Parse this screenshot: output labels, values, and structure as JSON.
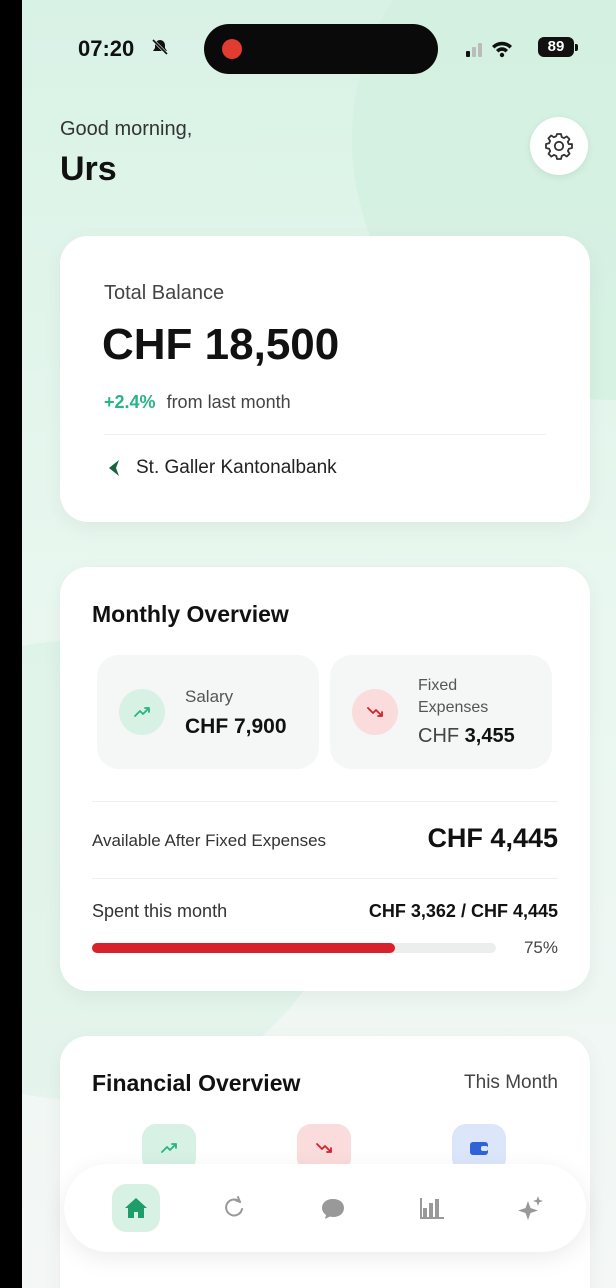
{
  "status": {
    "time": "07:20",
    "battery": "89"
  },
  "header": {
    "greeting": "Good morning,",
    "name": "Urs"
  },
  "balance": {
    "label": "Total Balance",
    "amount": "CHF 18,500",
    "change": "+2.4%",
    "change_suffix": "from last month",
    "bank": "St. Galler Kantonalbank"
  },
  "monthly": {
    "title": "Monthly Overview",
    "salary_label": "Salary",
    "salary_value": "CHF 7,900",
    "fixed_label_1": "Fixed",
    "fixed_label_2": "Expenses",
    "fixed_currency": "CHF",
    "fixed_value": "3,455",
    "available_label": "Available After Fixed Expenses",
    "available_value": "CHF 4,445",
    "spent_label": "Spent this month",
    "spent_value": "CHF 3,362 / CHF 4,445",
    "spent_percent_text": "75%",
    "spent_fraction": 0.75
  },
  "financial": {
    "title": "Financial Overview",
    "period": "This Month"
  },
  "colors": {
    "accent_green": "#27b585",
    "bar_red": "#d8212a",
    "nav_active": "#d7f1e4"
  },
  "nav_icons": [
    "home-icon",
    "refresh-icon",
    "chat-icon",
    "bar-chart-icon",
    "sparkle-icon"
  ]
}
